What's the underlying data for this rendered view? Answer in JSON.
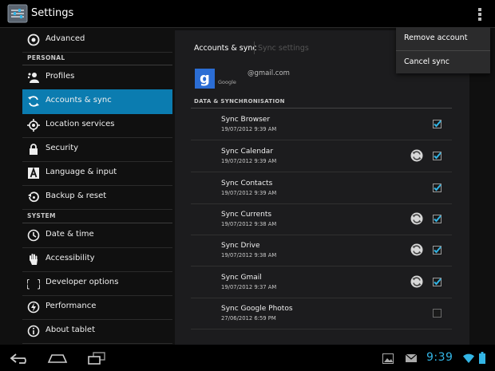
{
  "app_bar": {
    "title": "Settings",
    "overflow_icon": "overflow-menu-icon"
  },
  "sidebar": {
    "headers": {
      "personal": "PERSONAL",
      "system": "SYSTEM"
    },
    "items": [
      {
        "label": "Advanced",
        "icon": "advanced-icon"
      },
      {
        "label": "Profiles",
        "icon": "profiles-icon"
      },
      {
        "label": "Accounts & sync",
        "icon": "sync-icon",
        "selected": true
      },
      {
        "label": "Location services",
        "icon": "location-icon"
      },
      {
        "label": "Security",
        "icon": "lock-icon"
      },
      {
        "label": "Language & input",
        "icon": "language-icon"
      },
      {
        "label": "Backup & reset",
        "icon": "backup-icon"
      },
      {
        "label": "Date & time",
        "icon": "clock-icon"
      },
      {
        "label": "Accessibility",
        "icon": "hand-icon"
      },
      {
        "label": "Developer options",
        "icon": "braces-icon"
      },
      {
        "label": "Performance",
        "icon": "performance-icon"
      },
      {
        "label": "About tablet",
        "icon": "info-icon"
      }
    ]
  },
  "detail": {
    "tabs": {
      "active": "Accounts & sync",
      "inactive": "Sync settings"
    },
    "account": {
      "provider_label": "Google",
      "email": "@gmail.com"
    },
    "section_header": "DATA & SYNCHRONISATION",
    "sync_items": [
      {
        "name": "Sync Browser",
        "date": "19/07/2012 9:39 AM",
        "syncing": false,
        "checked": true
      },
      {
        "name": "Sync Calendar",
        "date": "19/07/2012 9:39 AM",
        "syncing": true,
        "checked": true
      },
      {
        "name": "Sync Contacts",
        "date": "19/07/2012 9:39 AM",
        "syncing": false,
        "checked": true
      },
      {
        "name": "Sync Currents",
        "date": "19/07/2012 9:38 AM",
        "syncing": true,
        "checked": true
      },
      {
        "name": "Sync Drive",
        "date": "19/07/2012 9:38 AM",
        "syncing": true,
        "checked": true
      },
      {
        "name": "Sync Gmail",
        "date": "19/07/2012 9:37 AM",
        "syncing": true,
        "checked": true
      },
      {
        "name": "Sync Google Photos",
        "date": "27/06/2012 6:59 PM",
        "syncing": false,
        "checked": false
      }
    ]
  },
  "overflow_menu": {
    "items": [
      "Remove account",
      "Cancel sync"
    ]
  },
  "system_bar": {
    "time": "9:39"
  },
  "colors": {
    "accent": "#33b5e5",
    "selected_row": "#0b7cb0",
    "checkbox": "#33b5e5"
  }
}
